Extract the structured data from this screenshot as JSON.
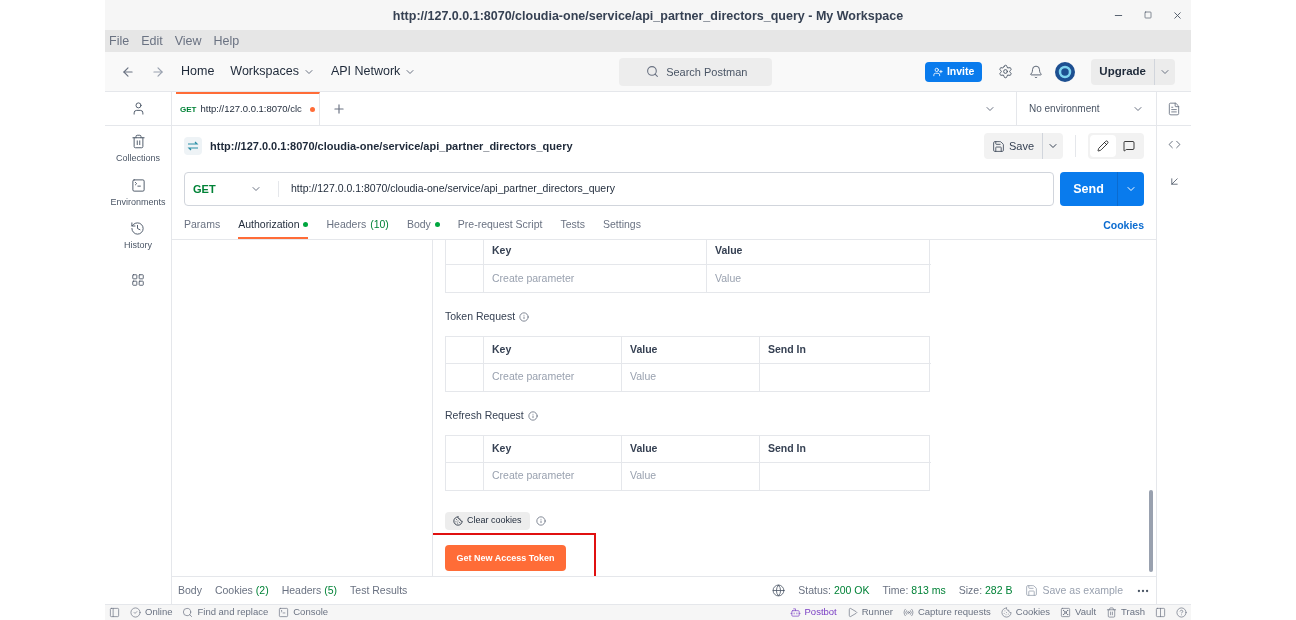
{
  "window": {
    "title": "http://127.0.0.1:8070/cloudia-one/service/api_partner_directors_query - My Workspace"
  },
  "menu": [
    "File",
    "Edit",
    "View",
    "Help"
  ],
  "top_nav": {
    "items": [
      {
        "label": "Home",
        "dropdown": false
      },
      {
        "label": "Workspaces",
        "dropdown": true
      },
      {
        "label": "API Network",
        "dropdown": true
      }
    ],
    "search": {
      "placeholder": "Search Postman"
    },
    "invite": "Invite",
    "upgrade": "Upgrade"
  },
  "request_tabs": [
    {
      "method": "GET",
      "label": "http://127.0.0.1:8070/clc",
      "unsaved": true,
      "selected": true
    }
  ],
  "environment": "No environment",
  "sidebar": {
    "items": [
      {
        "label": "Collections"
      },
      {
        "label": "Environments"
      },
      {
        "label": "History"
      }
    ]
  },
  "request": {
    "name": "http://127.0.0.1:8070/cloudia-one/service/api_partner_directors_query",
    "save": "Save",
    "method": "GET",
    "url": "http://127.0.0.1:8070/cloudia-one/service/api_partner_directors_query",
    "send": "Send"
  },
  "request_sections": [
    {
      "label": "Params",
      "selected": false,
      "dot": false
    },
    {
      "label": "Authorization",
      "selected": true,
      "dot": true
    },
    {
      "label": "Headers",
      "count": "(10)",
      "selected": false,
      "dot": false
    },
    {
      "label": "Body",
      "selected": false,
      "dot": true
    },
    {
      "label": "Pre-request Script",
      "selected": false,
      "dot": false
    },
    {
      "label": "Tests",
      "selected": false,
      "dot": false
    },
    {
      "label": "Settings",
      "selected": false,
      "dot": false
    }
  ],
  "cookies_link": "Cookies",
  "tables": [
    {
      "columns": [
        "Key",
        "Value"
      ],
      "placeholders": [
        "Create parameter",
        "Value"
      ]
    },
    {
      "title": "Token Request",
      "columns": [
        "Key",
        "Value",
        "Send In"
      ],
      "placeholders": [
        "Create parameter",
        "Value"
      ]
    },
    {
      "title": "Refresh Request",
      "columns": [
        "Key",
        "Value",
        "Send In"
      ],
      "placeholders": [
        "Create parameter",
        "Value"
      ]
    }
  ],
  "clear_cookies": "Clear cookies",
  "get_token": "Get New Access Token",
  "response_tabs": [
    {
      "label": "Body"
    },
    {
      "label": "Cookies",
      "count": "(2)"
    },
    {
      "label": "Headers",
      "count": "(5)"
    },
    {
      "label": "Test Results"
    }
  ],
  "response_meta": [
    {
      "label": "Status:",
      "value": "200 OK"
    },
    {
      "label": "Time:",
      "value": "813 ms"
    },
    {
      "label": "Size:",
      "value": "282 B"
    }
  ],
  "save_example": "Save as example",
  "status_bar": {
    "left": [
      "Online",
      "Find and replace",
      "Console"
    ],
    "right": [
      "Postbot",
      "Runner",
      "Capture requests",
      "Cookies",
      "Vault",
      "Trash"
    ]
  }
}
